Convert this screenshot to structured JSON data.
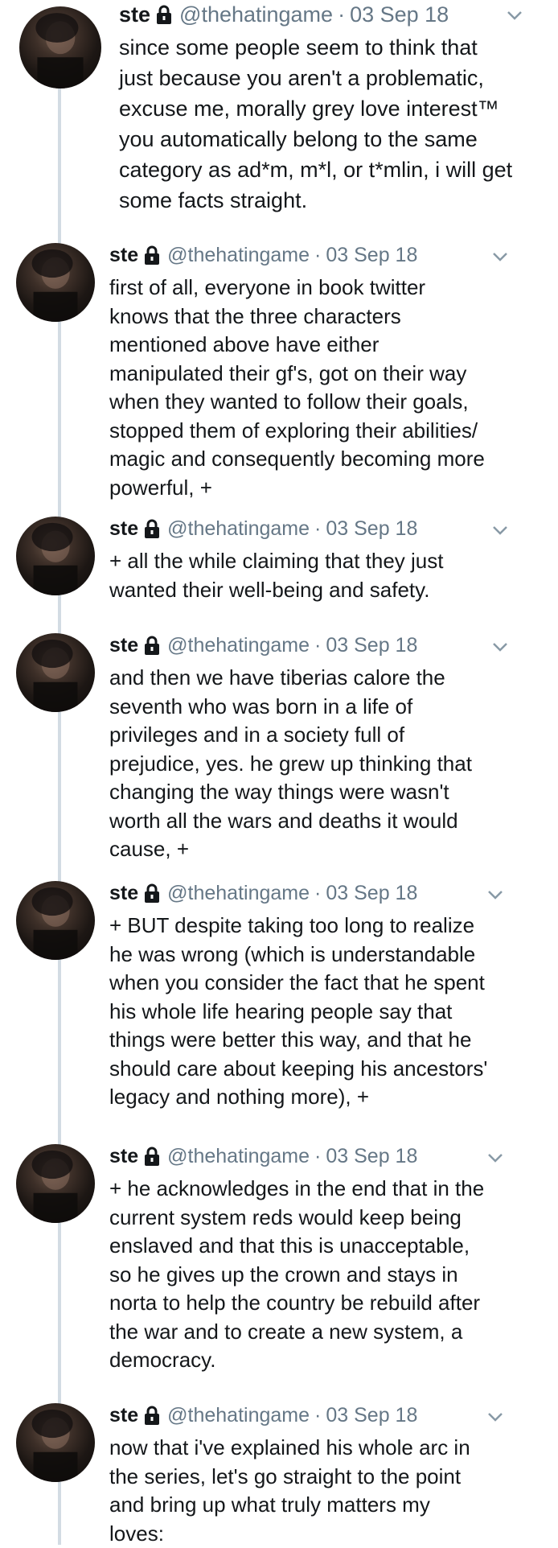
{
  "thread": {
    "tweets": [
      {
        "name": "ste",
        "handle": "@thehatingame",
        "separator": "·",
        "date": "03 Sep 18",
        "text": "since some people seem to think that\njust because you aren't a problematic,\nexcuse me, morally grey love interest™\nyou automatically belong to the same\ncategory as ad*m, m*l, or t*mlin, i will get\nsome facts straight."
      },
      {
        "name": "ste",
        "handle": "@thehatingame",
        "separator": "·",
        "date": "03 Sep 18",
        "text": "first of all, everyone in book twitter\nknows that the three characters\nmentioned above have either\nmanipulated their gf's, got on their way\nwhen they wanted to follow their goals,\nstopped them of exploring their abilities/\nmagic and consequently becoming more\npowerful, +"
      },
      {
        "name": "ste",
        "handle": "@thehatingame",
        "separator": "·",
        "date": "03 Sep 18",
        "text": "+ all the while claiming that they just\nwanted their well-being and safety."
      },
      {
        "name": "ste",
        "handle": "@thehatingame",
        "separator": "·",
        "date": "03 Sep 18",
        "text": "and then we have tiberias calore the\nseventh who was born in a life of\nprivileges and in a society full of\nprejudice, yes. he grew up thinking that\nchanging the way things were wasn't\nworth all the wars and deaths it would\ncause, +"
      },
      {
        "name": "ste",
        "handle": "@thehatingame",
        "separator": "·",
        "date": "03 Sep 18",
        "text": "+ BUT despite taking too long to realize\nhe was wrong (which is understandable\nwhen you consider the fact that he spent\nhis whole life hearing people say that\nthings were better this way, and that he\nshould care about keeping his ancestors'\nlegacy and nothing more), +"
      },
      {
        "name": "ste",
        "handle": "@thehatingame",
        "separator": "·",
        "date": "03 Sep 18",
        "text": "+ he acknowledges in the end that in the\ncurrent system reds would keep being\nenslaved and that this is unacceptable,\nso he gives up the crown and stays in\nnorta to help the country be rebuild after\nthe war and to create a new system, a\ndemocracy."
      },
      {
        "name": "ste",
        "handle": "@thehatingame",
        "separator": "·",
        "date": "03 Sep 18",
        "text": "now that i've explained his whole arc in\nthe series, let's go straight to the point\nand bring up what truly matters my\nloves:"
      }
    ]
  },
  "icons": {
    "lock": "lock-icon",
    "more": "chevron-down-icon"
  },
  "colors": {
    "text": "#14171a",
    "secondary": "#657786",
    "thread_line": "#d3dce3",
    "background": "#ffffff"
  }
}
